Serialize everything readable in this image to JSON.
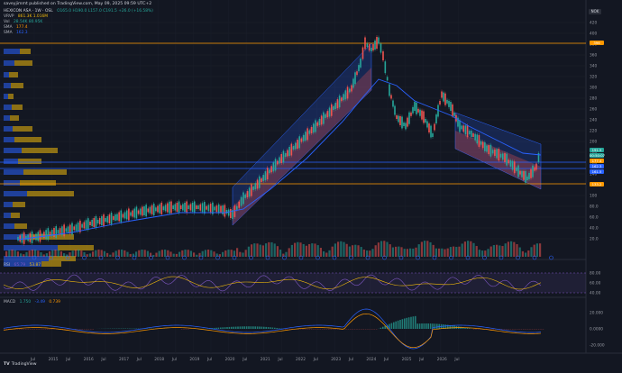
{
  "header": {
    "publisher": "saveyjimmt published on TradingView.com, May 09, 2025 09:59 UTC+2",
    "symbol_line": "HEXICON ASA · 1W · OSL",
    "ohlc": "O165.0  H190.0  L157.0  C191.5  +26.0 (+16.58%)"
  },
  "legend": {
    "vrvp": "VRVP",
    "vrvp_vals": "861.3K  1.016M",
    "vol": "Vol",
    "vol_vals": "28.54K  80.95K",
    "sma1": "SMA",
    "sma1_val": "177.4",
    "sma2": "SMA",
    "sma2_val": "162.3"
  },
  "currency": "NOK",
  "price_axis": [
    "420",
    "400",
    "380",
    "360",
    "340",
    "320",
    "300",
    "280",
    "260",
    "240",
    "220",
    "200",
    "180",
    "160",
    "140",
    "120",
    "100",
    "80.0",
    "60.0",
    "40.0",
    "20.0"
  ],
  "price_tags": {
    "top": "396",
    "last": "191.5",
    "timer": "00:50:07",
    "sma_a": "177.4",
    "sma_b": "162.3",
    "level_a": "161.5",
    "low": "133.2"
  },
  "x_axis": [
    "Jul",
    "2015",
    "Jul",
    "2016",
    "Jul",
    "2017",
    "Jul",
    "2018",
    "Jul",
    "2019",
    "Jul",
    "2020",
    "Jul",
    "2021",
    "Jul",
    "2022",
    "Jul",
    "2023",
    "Jul",
    "2024",
    "Jul",
    "2025",
    "Jul",
    "2026",
    "Jul"
  ],
  "rsi": {
    "label": "RSI",
    "v1": "65.79",
    "v2": "53.87",
    "axis": [
      "80.00",
      "60.00",
      "40.00"
    ]
  },
  "macd": {
    "label": "MACD",
    "v1": "1.750",
    "v2": "-3.49",
    "v3": "0.739",
    "axis": [
      "20.000",
      "0.0000",
      "-20.000"
    ]
  },
  "brand": "TradingView",
  "colors": {
    "bg": "#131722",
    "up": "#26a69a",
    "down": "#ef5350",
    "sma_blue": "#2962ff",
    "orange": "#ff9800",
    "rsi": "#7e57c2",
    "vp_blue": "#2962ff",
    "vp_yellow": "#f0b90b"
  }
}
